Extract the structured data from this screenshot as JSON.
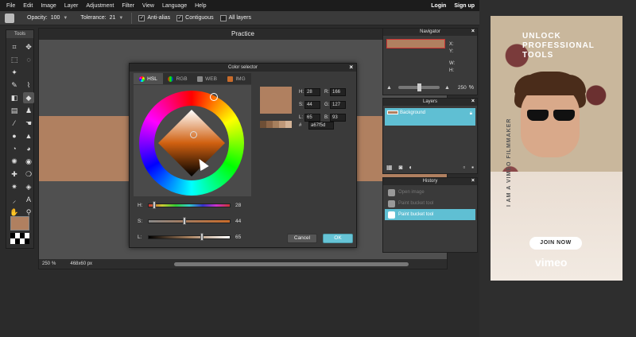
{
  "menu": {
    "items": [
      "File",
      "Edit",
      "Image",
      "Layer",
      "Adjustment",
      "Filter",
      "View",
      "Language",
      "Help"
    ],
    "login": "Login",
    "signup": "Sign up"
  },
  "options": {
    "opacity_label": "Opacity:",
    "opacity_value": "100",
    "tolerance_label": "Tolerance:",
    "tolerance_value": "21",
    "antialias_label": "Anti-alias",
    "contiguous_label": "Contiguous",
    "alllayers_label": "All layers",
    "check_mark": "✓"
  },
  "tools": {
    "title": "Tools",
    "foreground_color": "#b08060"
  },
  "canvas": {
    "title": "Practice",
    "zoom": "250",
    "zoom_unit": "%",
    "size": "468x60 px",
    "close_glyph": "×",
    "image_color": "#b08060"
  },
  "color_selector": {
    "title": "Color selector",
    "close_glyph": "×",
    "tabs": [
      {
        "label": "HSL",
        "active": true
      },
      {
        "label": "RGB",
        "active": false
      },
      {
        "label": "WEB",
        "active": false
      },
      {
        "label": "IMG",
        "active": false
      }
    ],
    "sliders": {
      "h_label": "H:",
      "h_value": "28",
      "h_level": 0.08,
      "s_label": "S:",
      "s_value": "44",
      "s_level": 0.44,
      "l_label": "L:",
      "l_value": "65",
      "l_level": 0.65
    },
    "fields": {
      "h_label": "H:",
      "h_value": "28",
      "r_label": "R:",
      "r_value": "166",
      "s_label": "S:",
      "s_value": "44",
      "g_label": "G:",
      "g_value": "127",
      "l_label": "L:",
      "l_value": "65",
      "b_label": "B:",
      "b_value": "93",
      "hex_label": "#",
      "hex_value": "a67f5d"
    },
    "preview_color": "#b08060",
    "shades": [
      "#6e4f36",
      "#8c6547",
      "#a67f5d",
      "#bf9878",
      "#d4b396"
    ],
    "cancel_label": "Cancel",
    "ok_label": "OK"
  },
  "navigator": {
    "title": "Navigator",
    "x_label": "X:",
    "y_label": "Y:",
    "w_label": "W:",
    "h_label": "H:",
    "zoom_value": "250",
    "zoom_unit": "%"
  },
  "layers": {
    "title": "Layers",
    "layer_name": "Background"
  },
  "history": {
    "title": "History",
    "items": [
      "Open image",
      "Paint bucket tool",
      "Paint bucket tool"
    ],
    "active_index": 2
  },
  "ad": {
    "headline": "UNLOCK PROFESSIONAL TOOLS",
    "tagline": "I AM A VIMEO FILMMAKER",
    "cta": "JOIN NOW",
    "brand": "vimeo"
  }
}
